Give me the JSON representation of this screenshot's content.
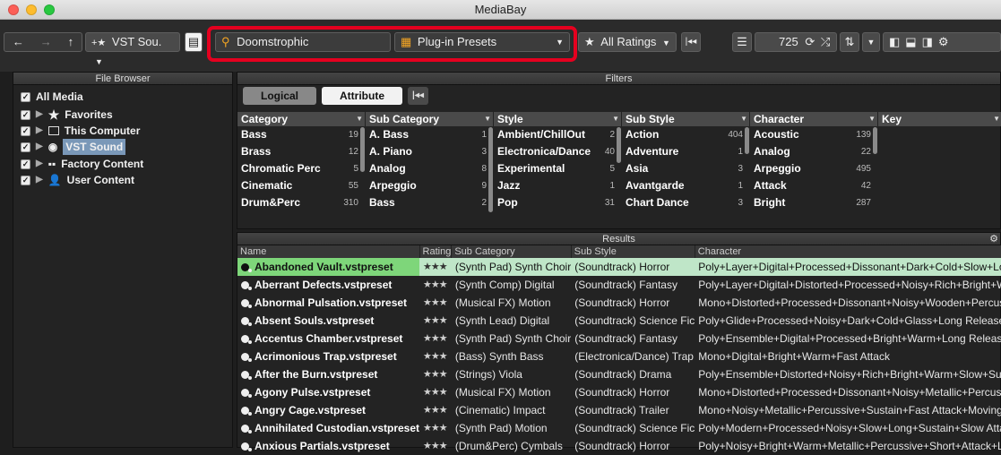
{
  "window": {
    "title": "MediaBay"
  },
  "toolbar": {
    "back": "←",
    "forward": "→",
    "up": "↑",
    "location_label": "VST Sou.",
    "search_value": "Doomstrophic",
    "content_type": "Plug-in Presets",
    "rating_filter": "All Ratings",
    "result_count": "725"
  },
  "file_browser": {
    "title": "File Browser",
    "items": [
      "All Media",
      "Favorites",
      "This Computer",
      "VST Sound",
      "Factory Content",
      "User Content"
    ]
  },
  "filters": {
    "title": "Filters",
    "tabs": [
      "Logical",
      "Attribute"
    ],
    "columns": [
      {
        "header": "Category",
        "rows": [
          [
            "Bass",
            "19"
          ],
          [
            "Brass",
            "12"
          ],
          [
            "Chromatic Perc",
            "5"
          ],
          [
            "Cinematic",
            "55"
          ],
          [
            "Drum&Perc",
            "310"
          ]
        ]
      },
      {
        "header": "Sub Category",
        "rows": [
          [
            "A. Bass",
            "1"
          ],
          [
            "A. Piano",
            "3"
          ],
          [
            "Analog",
            "8"
          ],
          [
            "Arpeggio",
            "9"
          ],
          [
            "Bass",
            "2"
          ]
        ]
      },
      {
        "header": "Style",
        "rows": [
          [
            "Ambient/ChillOut",
            "2"
          ],
          [
            "Electronica/Dance",
            "40"
          ],
          [
            "Experimental",
            "5"
          ],
          [
            "Jazz",
            "1"
          ],
          [
            "Pop",
            "31"
          ]
        ]
      },
      {
        "header": "Sub Style",
        "rows": [
          [
            "Action",
            "404"
          ],
          [
            "Adventure",
            "1"
          ],
          [
            "Asia",
            "3"
          ],
          [
            "Avantgarde",
            "1"
          ],
          [
            "Chart Dance",
            "3"
          ]
        ]
      },
      {
        "header": "Character",
        "rows": [
          [
            "Acoustic",
            "139"
          ],
          [
            "Analog",
            "22"
          ],
          [
            "Arpeggio",
            "495"
          ],
          [
            "Attack",
            "42"
          ],
          [
            "Bright",
            "287"
          ]
        ]
      },
      {
        "header": "Key",
        "rows": []
      }
    ]
  },
  "results": {
    "title": "Results",
    "headers": [
      "Name",
      "Rating",
      "Sub Category",
      "Sub Style",
      "Character"
    ],
    "rows": [
      [
        "Abandoned Vault.vstpreset",
        "★★★",
        "(Synth Pad) Synth Choir",
        "(Soundtrack) Horror",
        "Poly+Layer+Digital+Processed+Dissonant+Dark+Cold+Slow+Long F"
      ],
      [
        "Aberrant Defects.vstpreset",
        "★★★",
        "(Synth Comp) Digital",
        "(Soundtrack) Fantasy",
        "Poly+Layer+Digital+Distorted+Processed+Noisy+Rich+Bright+Warm"
      ],
      [
        "Abnormal Pulsation.vstpreset",
        "★★★",
        "(Musical FX) Motion",
        "(Soundtrack) Horror",
        "Mono+Distorted+Processed+Dissonant+Noisy+Wooden+Percussive"
      ],
      [
        "Absent Souls.vstpreset",
        "★★★",
        "(Synth Lead) Digital",
        "(Soundtrack) Science Fic",
        "Poly+Glide+Processed+Noisy+Dark+Cold+Glass+Long Release+Mo"
      ],
      [
        "Accentus Chamber.vstpreset",
        "★★★",
        "(Synth Pad) Synth Choir",
        "(Soundtrack) Fantasy",
        "Poly+Ensemble+Digital+Processed+Bright+Warm+Long Release"
      ],
      [
        "Acrimonious Trap.vstpreset",
        "★★★",
        "(Bass) Synth Bass",
        "(Electronica/Dance) Trap",
        "Mono+Digital+Bright+Warm+Fast Attack"
      ],
      [
        "After the Burn.vstpreset",
        "★★★",
        "(Strings) Viola",
        "(Soundtrack) Drama",
        "Poly+Ensemble+Distorted+Noisy+Rich+Bright+Warm+Slow+Sustain"
      ],
      [
        "Agony Pulse.vstpreset",
        "★★★",
        "(Musical FX) Motion",
        "(Soundtrack) Horror",
        "Mono+Distorted+Processed+Dissonant+Noisy+Metallic+Percussive+"
      ],
      [
        "Angry Cage.vstpreset",
        "★★★",
        "(Cinematic) Impact",
        "(Soundtrack) Trailer",
        "Mono+Noisy+Metallic+Percussive+Sustain+Fast Attack+Moving+On"
      ],
      [
        "Annihilated Custodian.vstpreset",
        "★★★",
        "(Synth Pad) Motion",
        "(Soundtrack) Science Fic",
        "Poly+Modern+Processed+Noisy+Slow+Long+Sustain+Slow Attack+"
      ],
      [
        "Anxious Partials.vstpreset",
        "★★★",
        "(Drum&Perc) Cymbals",
        "(Soundtrack) Horror",
        "Poly+Noisy+Bright+Warm+Metallic+Percussive+Short+Attack+Loop+"
      ]
    ]
  },
  "colors": {
    "highlight_red": "#e5001f",
    "selected_row": "#7ed67a",
    "search_icon": "#f5a623"
  }
}
